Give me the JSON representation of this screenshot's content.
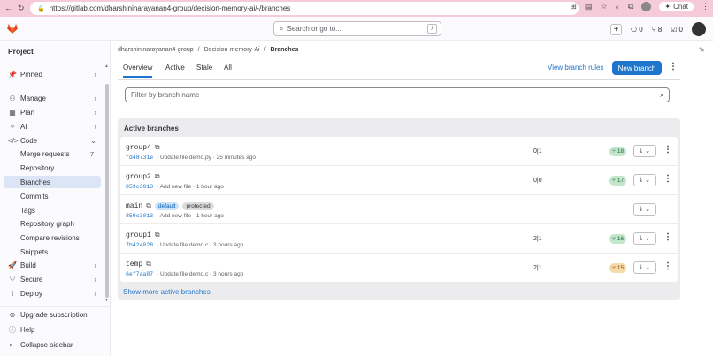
{
  "browser": {
    "url": "https://gitlab.com/dharshininarayanan4-group/decision-memory-ai/-/branches",
    "chat_label": "Chat"
  },
  "topbar": {
    "search_placeholder": "Search or go to...",
    "search_shortcut": "/",
    "issues_count": "0",
    "mr_count": "8",
    "todo_count": "0"
  },
  "sidebar": {
    "title": "Project",
    "items": [
      {
        "label": "Pinned",
        "icon": "pin-icon",
        "chevron": "›"
      },
      {
        "label": "Manage",
        "icon": "users-icon",
        "chevron": "›"
      },
      {
        "label": "Plan",
        "icon": "plan-icon",
        "chevron": "›"
      },
      {
        "label": "AI",
        "icon": "ai-icon",
        "chevron": "›"
      },
      {
        "label": "Code",
        "icon": "code-icon",
        "chevron": "⌄"
      },
      {
        "label": "Merge requests",
        "count": "7"
      },
      {
        "label": "Repository"
      },
      {
        "label": "Branches"
      },
      {
        "label": "Commits"
      },
      {
        "label": "Tags"
      },
      {
        "label": "Repository graph"
      },
      {
        "label": "Compare revisions"
      },
      {
        "label": "Snippets"
      },
      {
        "label": "Build",
        "icon": "rocket-icon",
        "chevron": "›"
      },
      {
        "label": "Secure",
        "icon": "shield-icon",
        "chevron": "›"
      },
      {
        "label": "Deploy",
        "icon": "deploy-icon",
        "chevron": "›"
      }
    ],
    "bottom": [
      {
        "label": "Upgrade subscription",
        "icon": "upgrade-icon"
      },
      {
        "label": "Help",
        "icon": "help-icon"
      },
      {
        "label": "Collapse sidebar",
        "icon": "collapse-icon"
      }
    ]
  },
  "breadcrumb": [
    "dharshininarayanan4-group",
    "Decision-memory-Ai",
    "Branches"
  ],
  "tabs": [
    "Overview",
    "Active",
    "Stale",
    "All"
  ],
  "actions": {
    "view_rules": "View branch rules",
    "new_branch": "New branch"
  },
  "filter": {
    "placeholder": "Filter by branch name"
  },
  "panel": {
    "title": "Active branches",
    "show_more": "Show more active branches"
  },
  "branches": [
    {
      "name": "group4",
      "sha": "fd48731e",
      "message": "· Update file demo.py · 25 minutes ago",
      "behind": "0",
      "ahead": "1",
      "mr": "18",
      "mr_color": "green"
    },
    {
      "name": "group2",
      "sha": "859c3013",
      "message": "· Add new file · 1 hour ago",
      "behind": "0",
      "ahead": "0",
      "mr": "17",
      "mr_color": "green"
    },
    {
      "name": "main",
      "sha": "859c3013",
      "message": "· Add new file · 1 hour ago",
      "badges": [
        "default",
        "protected"
      ]
    },
    {
      "name": "group1",
      "sha": "7b424028",
      "message": "· Update file demo.c · 3 hours ago",
      "behind": "2",
      "ahead": "1",
      "mr": "16",
      "mr_color": "green"
    },
    {
      "name": "temp",
      "sha": "6ef7aa87",
      "message": "· Update file demo.c · 3 hours ago",
      "behind": "2",
      "ahead": "1",
      "mr": "15",
      "mr_color": "orange"
    }
  ]
}
